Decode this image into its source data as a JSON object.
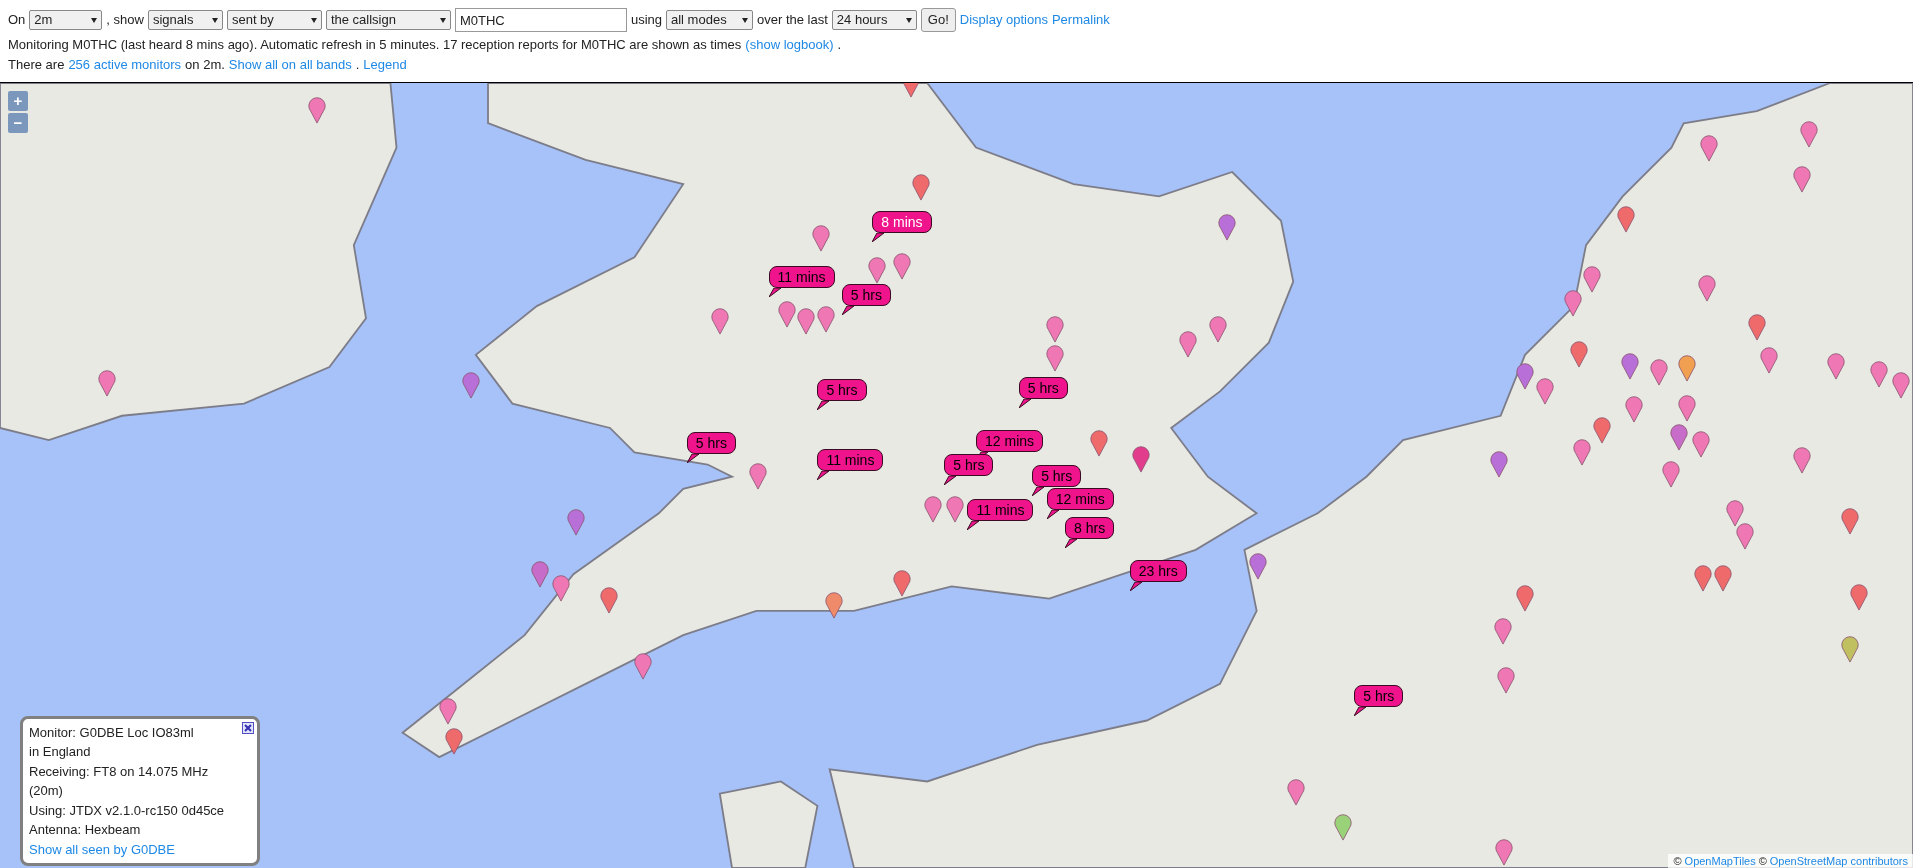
{
  "toolbar": [
    {
      "kind": "text",
      "text": "On"
    },
    {
      "kind": "select",
      "value": "2m"
    },
    {
      "kind": "text",
      "text": ", show"
    },
    {
      "kind": "select",
      "value": "signals"
    },
    {
      "kind": "select",
      "value": "sent by"
    },
    {
      "kind": "select",
      "value": "the callsign"
    },
    {
      "kind": "input",
      "value": "M0THC"
    },
    {
      "kind": "text",
      "text": "using"
    },
    {
      "kind": "select",
      "value": "all modes"
    },
    {
      "kind": "text",
      "text": "over the last"
    },
    {
      "kind": "select",
      "value": "24 hours"
    },
    {
      "kind": "button",
      "text": "Go!"
    },
    {
      "kind": "link",
      "text": "Display options"
    },
    {
      "kind": "link",
      "text": "Permalink"
    }
  ],
  "status_lines": [
    [
      {
        "kind": "text",
        "text": "Monitoring M0THC (last heard 8 mins ago). Automatic refresh in 5 minutes. 17 reception reports for M0THC are shown as times"
      },
      {
        "kind": "link",
        "text": "(show logbook)"
      },
      {
        "kind": "text",
        "text": "."
      }
    ],
    [
      {
        "kind": "text",
        "text": "There are"
      },
      {
        "kind": "link",
        "text": "256 active monitors"
      },
      {
        "kind": "text",
        "text": "on 2m."
      },
      {
        "kind": "link",
        "text": "Show all on all bands"
      },
      {
        "kind": "text",
        "text": "."
      },
      {
        "kind": "link",
        "text": "Legend"
      }
    ]
  ],
  "map": {
    "zoom_buttons": [
      "+",
      "−"
    ],
    "pins": [
      {
        "color": "#ee77b4"
      },
      {
        "color": "#ee77b4"
      },
      {
        "color": "#b870d8"
      },
      {
        "color": "#b870d8"
      },
      {
        "color": "#c76cc8"
      },
      {
        "color": "#ee77b4"
      },
      {
        "color": "#ef6a6a"
      },
      {
        "color": "#ee77b4"
      },
      {
        "color": "#ee77b4"
      },
      {
        "color": "#ef6a6a"
      },
      {
        "color": "#ee77b4"
      },
      {
        "color": "#ee77b4"
      },
      {
        "color": "#ee77b4"
      },
      {
        "color": "#ee77b4"
      },
      {
        "color": "#ee77b4"
      },
      {
        "color": "#ee77b4"
      },
      {
        "color": "#ee77b4"
      },
      {
        "color": "#ef6a6a"
      },
      {
        "color": "#ef6a6a"
      },
      {
        "color": "#ee77b4"
      },
      {
        "color": "#ef8a6a"
      },
      {
        "color": "#ef6a6a"
      },
      {
        "color": "#ee77b4"
      },
      {
        "color": "#ee77b4"
      },
      {
        "color": "#ee77b4"
      },
      {
        "color": "#ee77b4"
      },
      {
        "color": "#ef6a6a"
      },
      {
        "color": "#e23c8c"
      },
      {
        "color": "#ee77b4"
      },
      {
        "color": "#ee77b4"
      },
      {
        "color": "#b870d8"
      },
      {
        "color": "#b870d8"
      },
      {
        "color": "#ee77b4"
      },
      {
        "color": "#9ad27a"
      },
      {
        "color": "#ee77b4"
      },
      {
        "color": "#ee77b4"
      },
      {
        "color": "#ee77b4"
      },
      {
        "color": "#ef6a6a"
      },
      {
        "color": "#b870d8"
      },
      {
        "color": "#b870d8"
      },
      {
        "color": "#ee77b4"
      },
      {
        "color": "#ef6a6a"
      },
      {
        "color": "#ee77b4"
      },
      {
        "color": "#ee77b4"
      },
      {
        "color": "#ef6a6a"
      },
      {
        "color": "#b870d8"
      },
      {
        "color": "#ee77b4"
      },
      {
        "color": "#f0a050"
      },
      {
        "color": "#ee77b4"
      },
      {
        "color": "#ee77b4"
      },
      {
        "color": "#c76cc8"
      },
      {
        "color": "#ee77b4"
      },
      {
        "color": "#ef6a6a"
      },
      {
        "color": "#ee77b4"
      },
      {
        "color": "#ee77b4"
      },
      {
        "color": "#ee77b4"
      },
      {
        "color": "#ee77b4"
      },
      {
        "color": "#ef6a6a"
      },
      {
        "color": "#ee77b4"
      },
      {
        "color": "#ee77b4"
      },
      {
        "color": "#ee77b4"
      },
      {
        "color": "#ee77b4"
      },
      {
        "color": "#ee77b4"
      },
      {
        "color": "#ee77b4"
      },
      {
        "color": "#ee77b4"
      },
      {
        "color": "#ef6a6a"
      },
      {
        "color": "#ef6a6a"
      },
      {
        "color": "#ee77b4"
      },
      {
        "color": "#ef6a6a"
      },
      {
        "color": "#ef6a6a"
      },
      {
        "color": "#c0c060"
      },
      {
        "color": "#ee77b4"
      }
    ],
    "time_labels": [
      {
        "text": "8 mins",
        "latest": true
      },
      {
        "text": "11 mins",
        "latest": false
      },
      {
        "text": "5 hrs",
        "latest": false
      },
      {
        "text": "5 hrs",
        "latest": false
      },
      {
        "text": "5 hrs",
        "latest": false
      },
      {
        "text": "5 hrs",
        "latest": false
      },
      {
        "text": "11 mins",
        "latest": false
      },
      {
        "text": "12 mins",
        "latest": false
      },
      {
        "text": "5 hrs",
        "latest": false
      },
      {
        "text": "5 hrs",
        "latest": false
      },
      {
        "text": "12 mins",
        "latest": false
      },
      {
        "text": "11 mins",
        "latest": false
      },
      {
        "text": "8 hrs",
        "latest": false
      },
      {
        "text": "23 hrs",
        "latest": false
      },
      {
        "text": "5 hrs",
        "latest": false
      }
    ],
    "popup": {
      "lines": [
        "Monitor: G0DBE Loc IO83ml",
        "in England",
        "Receiving: FT8 on 14.075 MHz (20m)",
        "Using: JTDX v2.1.0-rc150 0d45ce",
        "Antenna: Hexbeam"
      ],
      "link": "Show all seen by G0DBE"
    },
    "attribution": [
      {
        "kind": "text",
        "text": "©"
      },
      {
        "kind": "link",
        "text": "OpenMapTiles"
      },
      {
        "kind": "text",
        "text": "©"
      },
      {
        "kind": "link",
        "text": "OpenStreetMap contributors"
      }
    ]
  }
}
